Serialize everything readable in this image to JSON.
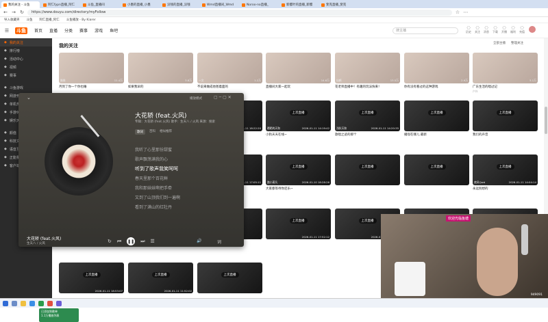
{
  "browser": {
    "tabs": [
      {
        "label": "我的关注 - 斗鱼",
        "active": true
      },
      {
        "label": "阿仁fypn直播_阿仁",
        "active": false
      },
      {
        "label": "斗鱼_直播间",
        "active": false
      },
      {
        "label": "小墨的直播_小墨",
        "active": false
      },
      {
        "label": "没钱的直播_没钱",
        "active": false
      },
      {
        "label": "Wmd直播间_Wmd",
        "active": false
      },
      {
        "label": "Noroo-no直播_",
        "active": false
      },
      {
        "label": "新樱叶的直播_新樱",
        "active": false
      },
      {
        "label": "斐克直播_斐克",
        "active": false
      }
    ],
    "url": "https://www.douyu.com/directory/myFollow",
    "bookmarks": [
      "导入收藏夹",
      "斗鱼",
      "阿仁直播_阿仁",
      "斗鱼播放 - By Kiarer"
    ]
  },
  "header": {
    "logo": "斗鱼",
    "nav": [
      "首页",
      "直播",
      "分类",
      "赛事",
      "游戏",
      "鱼吧"
    ],
    "search_placeholder": "搜主播",
    "icons": [
      {
        "name": "history-icon",
        "label": "历史"
      },
      {
        "name": "follow-icon",
        "label": "关注"
      },
      {
        "name": "message-icon",
        "label": "消息"
      },
      {
        "name": "download-icon",
        "label": "下载"
      },
      {
        "name": "live-start-icon",
        "label": "开播"
      },
      {
        "name": "gift-icon",
        "label": "福利"
      },
      {
        "name": "wallet-icon",
        "label": "充值"
      }
    ]
  },
  "sidebar": {
    "items": [
      {
        "label": "我的关注",
        "active": true
      },
      {
        "label": "排行榜",
        "active": false
      },
      {
        "label": "活动中心",
        "active": false
      },
      {
        "label": "视频",
        "active": false
      },
      {
        "label": "赛事",
        "active": false
      },
      {
        "label": "斗鱼游戏",
        "active": false
      },
      {
        "label": "网游竞技",
        "active": false
      },
      {
        "label": "单机热游",
        "active": false
      },
      {
        "label": "手游休闲",
        "active": false
      },
      {
        "label": "娱乐天地",
        "active": false
      },
      {
        "label": "颜值",
        "active": false
      },
      {
        "label": "科技文化",
        "active": false
      },
      {
        "label": "语音互动",
        "active": false
      },
      {
        "label": "正能量",
        "active": false
      },
      {
        "label": "客户端",
        "active": false
      }
    ]
  },
  "main": {
    "title": "我的关注",
    "filters": [
      "全部主播",
      "整理关注"
    ],
    "cards": [
      {
        "title": "月到了你一个你也睡",
        "tag": "",
        "status": "live",
        "badge": "",
        "name": "姝姝",
        "count": "11.4万"
      },
      {
        "title": "如果我早的",
        "tag": "",
        "status": "live",
        "badge": "",
        "name": "",
        "count": "3.8万"
      },
      {
        "title": "不说来做成他爸着面的",
        "tag": "",
        "status": "live",
        "badge": "",
        "name": "一文",
        "count": "1.2万"
      },
      {
        "title": "直播间大家一起玩",
        "tag": "",
        "status": "live",
        "badge": "",
        "name": "",
        "count": "14.6万"
      },
      {
        "title": "花老师直播中！有趣的玩法快来！",
        "tag": "",
        "status": "live",
        "badge": "",
        "name": "仙鹤",
        "count": "13.5万"
      },
      {
        "title": "你有没有看过的这种游戏",
        "tag": "",
        "status": "live",
        "badge": "",
        "name": "",
        "count": "2.9万"
      },
      {
        "title": "广东生活的唱过记",
        "tag": "户外",
        "status": "live",
        "badge": "",
        "name": "",
        "count": "5.1万"
      },
      {
        "title": "你能一点到1?",
        "tag": "",
        "status": "live",
        "badge": "",
        "name": "",
        "count": "8.8万"
      },
      {
        "title": "中午打法 只打不玩你就当不爱看",
        "tag": "CS",
        "status": "off",
        "badge": "上次直播",
        "name": "",
        "count": ""
      },
      {
        "title": "今天同天快乐一下 VS号开播",
        "tag": "户外",
        "status": "off",
        "badge": "上次直播",
        "name": "小小花",
        "count": "2026-01-11 18:22:20"
      },
      {
        "title": "小狗天天在线~",
        "tag": "",
        "status": "off",
        "badge": "上次直播",
        "name": "晒晒的天和",
        "count": "2026-01-11 14:19:42"
      },
      {
        "title": "歌唱之迹的那个",
        "tag": "",
        "status": "off",
        "badge": "上次直播",
        "name": "浅秋天和",
        "count": "2026-01-11 14:20:35"
      },
      {
        "title": "播现在哪儿 最新",
        "tag": "",
        "status": "off",
        "badge": "上次直播",
        "name": "",
        "count": ""
      },
      {
        "title": "我们的声音",
        "tag": "",
        "status": "off",
        "badge": "上次直播",
        "name": "",
        "count": ""
      },
      {
        "title": "拼搏在直播中的直播",
        "tag": "",
        "status": "off",
        "badge": "上次直播",
        "name": "若曦河",
        "count": "2026-01-11 21:08:42"
      },
      {
        "title": "#1st Annix",
        "tag": "",
        "status": "off",
        "badge": "上次直播",
        "name": "小镜白天",
        "count": "2026-01-11 12:57:52"
      },
      {
        "title": "欢欢艺术 从我做起",
        "tag": "LOVE",
        "status": "off",
        "badge": "上次直播",
        "name": "大大、、、、",
        "count": "2026-01-11 17:05:11"
      },
      {
        "title": "大家都等待你还乐~",
        "tag": "",
        "status": "off",
        "badge": "上次直播",
        "name": "路小燕凡",
        "count": "2026-01-10 18:28:26"
      },
      {
        "title": "",
        "tag": "",
        "status": "off",
        "badge": "上次直播",
        "name": "",
        "count": ""
      },
      {
        "title": "",
        "tag": "",
        "status": "off",
        "badge": "上次直播",
        "name": "",
        "count": ""
      },
      {
        "title": "永远别想的",
        "tag": "",
        "status": "off",
        "badge": "上次直播",
        "name": "夜风Qwd",
        "count": "2026-01-11 14:04:14"
      },
      {
        "title": "美丽对大大人~",
        "tag": "",
        "status": "off",
        "badge": "上次直播",
        "name": "小鸡Pz",
        "count": "2026-01-11 16:50:00"
      },
      {
        "title": "",
        "tag": "",
        "status": "off",
        "badge": "上次直播",
        "name": "",
        "count": ""
      },
      {
        "title": "",
        "tag": "",
        "status": "off",
        "badge": "上次直播",
        "name": "",
        "count": ""
      },
      {
        "title": "",
        "tag": "",
        "status": "off",
        "badge": "上次直播",
        "name": "",
        "count": "2026-01-11 17:52:12"
      },
      {
        "title": "",
        "tag": "",
        "status": "off",
        "badge": "上次直播",
        "name": "",
        "count": "2026-01-11 17:29:05"
      },
      {
        "title": "",
        "tag": "",
        "status": "off",
        "badge": "上次直播",
        "name": "",
        "count": "2026-01-11 19:48:05"
      },
      {
        "title": "",
        "tag": "",
        "status": "off",
        "badge": "上次直播",
        "name": "",
        "count": "2026-01-11 21:03:49"
      },
      {
        "title": "",
        "tag": "",
        "status": "off",
        "badge": "上次直播",
        "name": "",
        "count": "2026-01-11 18:53:07"
      },
      {
        "title": "",
        "tag": "",
        "status": "off",
        "badge": "上次直播",
        "name": "",
        "count": "2026-01-11 11:52:02"
      },
      {
        "title": "",
        "tag": "",
        "status": "off",
        "badge": "上次直播",
        "name": "",
        "count": ""
      }
    ]
  },
  "player": {
    "title": "大花轿 (feat.火风)",
    "meta": "专辑：大花轿 (feat.火风)   歌手：生天八 / 火风   来源：搜索",
    "tabs": [
      "歌词",
      "百科",
      "相似推荐"
    ],
    "lyrics": [
      "我听了心里那份甜蜜",
      "歌声飘荡满我的心",
      "听到了歌声我笑呵呵",
      "春天里那个百花鲜",
      "我和那妹妹啊把手牵",
      "又到了山顶我们到一遍啊",
      "看到了满山的红牡丹"
    ],
    "current_index": 2,
    "now_title": "大花轿 (feat.火风)",
    "now_artist": "生天八 / 火风",
    "mode_label": "播放模式",
    "toast_line1": "已添加到歌单",
    "toast_line2": "1.1万播放列表"
  },
  "webcam": {
    "tag": "欢迎光临鱼塘",
    "room_id": "949091"
  },
  "taskbar": {
    "time": "",
    "date": ""
  }
}
